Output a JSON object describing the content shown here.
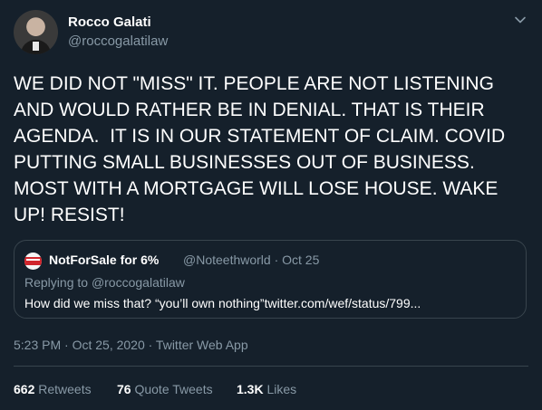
{
  "author": {
    "name": "Rocco Galati",
    "handle": "@roccogalatilaw"
  },
  "icons": {
    "menu": "chevron-down-icon",
    "avatar": "profile-photo"
  },
  "tweet_text": "WE DID NOT \"MISS\" IT. PEOPLE ARE NOT LISTENING AND WOULD RATHER BE IN DENIAL. THAT IS THEIR AGENDA.  IT IS IN OUR STATEMENT OF CLAIM. COVID PUTTING SMALL BUSINESSES OUT OF BUSINESS. MOST WITH A MORTGAGE WILL LOSE HOUSE. WAKE UP! RESIST!",
  "quoted": {
    "name": "NotForSale for 6%",
    "meta": "@Noteethworld · Oct 25",
    "replying_prefix": "Replying to ",
    "replying_handle": "@roccogalatilaw",
    "text": "How did we miss that? “you’ll own nothing”twitter.com/wef/status/799..."
  },
  "timestamp": "5:23 PM · Oct 25, 2020 · Twitter Web App",
  "stats": {
    "retweets_count": "662",
    "retweets_label": "Retweets",
    "quotes_count": "76",
    "quotes_label": "Quote Tweets",
    "likes_count": "1.3K",
    "likes_label": "Likes"
  },
  "colors": {
    "background": "#15202b",
    "text": "#ffffff",
    "secondary": "#8899a6",
    "border": "#38444d"
  }
}
